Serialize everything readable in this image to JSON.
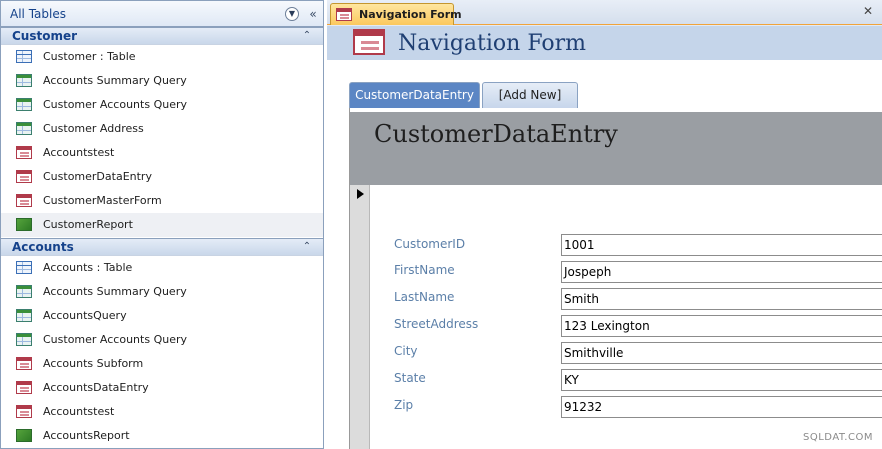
{
  "nav_pane": {
    "title": "All Tables",
    "groups": [
      {
        "label": "Customer",
        "items": [
          {
            "label": "Customer : Table",
            "icon": "table-icon"
          },
          {
            "label": "Accounts Summary Query",
            "icon": "query-icon"
          },
          {
            "label": "Customer Accounts Query",
            "icon": "query-icon"
          },
          {
            "label": "Customer Address",
            "icon": "query-icon"
          },
          {
            "label": "Accountstest",
            "icon": "form-icon"
          },
          {
            "label": "CustomerDataEntry",
            "icon": "form-icon"
          },
          {
            "label": "CustomerMasterForm",
            "icon": "form-icon"
          },
          {
            "label": "CustomerReport",
            "icon": "report-icon"
          }
        ]
      },
      {
        "label": "Accounts",
        "items": [
          {
            "label": "Accounts : Table",
            "icon": "table-icon"
          },
          {
            "label": "Accounts Summary Query",
            "icon": "query-icon"
          },
          {
            "label": "AccountsQuery",
            "icon": "query-icon"
          },
          {
            "label": "Customer Accounts Query",
            "icon": "query-icon"
          },
          {
            "label": "Accounts Subform",
            "icon": "form-icon"
          },
          {
            "label": "AccountsDataEntry",
            "icon": "form-icon"
          },
          {
            "label": "Accountstest",
            "icon": "form-icon"
          },
          {
            "label": "AccountsReport",
            "icon": "report-icon"
          }
        ]
      }
    ]
  },
  "document": {
    "tab_label": "Navigation Form",
    "form_title": "Navigation Form",
    "nav_tabs": [
      {
        "label": "CustomerDataEntry"
      },
      {
        "label": "[Add New]"
      }
    ],
    "subform_title": "CustomerDataEntry",
    "fields": [
      {
        "label": "CustomerID",
        "value": "1001"
      },
      {
        "label": "FirstName",
        "value": "Jospeph"
      },
      {
        "label": "LastName",
        "value": "Smith"
      },
      {
        "label": "StreetAddress",
        "value": "123 Lexington"
      },
      {
        "label": "City",
        "value": "Smithville"
      },
      {
        "label": "State",
        "value": "KY"
      },
      {
        "label": "Zip",
        "value": "91232"
      }
    ]
  },
  "watermark": "SQLDAT.COM",
  "colors": {
    "accent_tab": "#fbc85e",
    "selected_nav_tab": "#5b86c4",
    "form_header": "#c5d5ea",
    "field_label": "#5b7fa8"
  }
}
